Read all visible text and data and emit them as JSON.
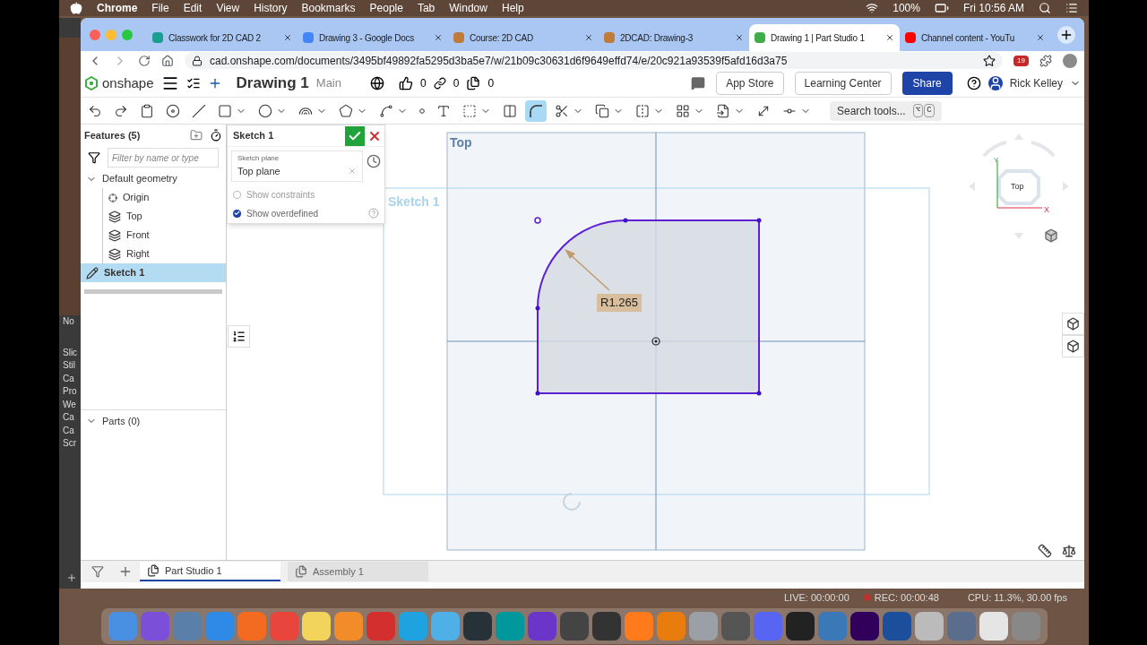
{
  "menu_bar": {
    "app": "Chrome",
    "menus": [
      "File",
      "Edit",
      "View",
      "History",
      "Bookmarks",
      "People",
      "Tab",
      "Window",
      "Help"
    ],
    "battery": "100%",
    "clock": "Fri 10:56 AM"
  },
  "background_window": {
    "lines": [
      "No",
      "Slic",
      "Stil",
      "Ca",
      "Pro",
      "We",
      "Ca",
      "Ca",
      "Scr"
    ]
  },
  "browser": {
    "tabs": [
      {
        "title": "Classwork for 2D CAD 2",
        "selected": false
      },
      {
        "title": "Drawing 3 - Google Docs",
        "selected": false
      },
      {
        "title": "Course: 2D CAD",
        "selected": false
      },
      {
        "title": "2DCAD: Drawing-3",
        "selected": false
      },
      {
        "title": "Drawing 1 | Part Studio 1",
        "selected": true
      },
      {
        "title": "Channel content - YouTu",
        "selected": false
      }
    ],
    "url": "cad.onshape.com/documents/3495bf49892fa5295d3ba5e7/w/21b09c30631d6f9649effd74/e/20c921a93539f5afd16d3a75",
    "extension_badge": "19"
  },
  "header": {
    "logo": "onshape",
    "document": "Drawing 1",
    "branch": "Main",
    "likes": "0",
    "links": "0",
    "copies": "0",
    "buttons": [
      "App Store",
      "Learning Center"
    ],
    "share": "Share",
    "user": "Rick Kelley"
  },
  "toolbar": {
    "tools": [
      {
        "selected": false
      },
      {
        "selected": false
      },
      {
        "selected": false
      },
      {
        "selected": false
      },
      {
        "selected": false
      },
      {
        "selected": false
      },
      {
        "selected": false
      },
      {
        "selected": false
      },
      {
        "selected": false
      },
      {
        "selected": false
      },
      {
        "selected": false
      },
      {
        "selected": false
      },
      {
        "selected": false
      },
      {
        "selected": false
      },
      {
        "selected": true
      },
      {
        "selected": false
      },
      {
        "selected": false
      },
      {
        "selected": false
      },
      {
        "selected": false
      },
      {
        "selected": false
      },
      {
        "selected": false
      },
      {
        "selected": false
      }
    ],
    "search": "Search tools...",
    "shortcut": [
      "⌥",
      "C"
    ]
  },
  "features": {
    "title": "Features (5)",
    "filter_placeholder": "Filter by name or type",
    "tree": [
      {
        "label": "Default geometry",
        "kind": "folder",
        "expanded": true,
        "selected": false,
        "children": [
          {
            "label": "Origin",
            "kind": "origin",
            "selected": false
          },
          {
            "label": "Top",
            "kind": "plane",
            "selected": false
          },
          {
            "label": "Front",
            "kind": "plane",
            "selected": false
          },
          {
            "label": "Right",
            "kind": "plane",
            "selected": false
          }
        ]
      },
      {
        "label": "Sketch 1",
        "kind": "sketch",
        "selected": true
      }
    ],
    "parts": {
      "label": "Parts (0)",
      "expanded": true
    }
  },
  "sketch_dialog": {
    "title": "Sketch 1",
    "plane_label": "Sketch plane",
    "plane_value": "Top plane",
    "options": [
      {
        "label": "Show constraints",
        "checked": false
      },
      {
        "label": "Show overdefined",
        "checked": true
      }
    ]
  },
  "viewport": {
    "plane_label": "Top",
    "sketch_label": "Sketch 1",
    "dimension": "R1.265",
    "view_cube": {
      "face": "Top",
      "y_axis": "Y",
      "x_axis": "X"
    }
  },
  "bottom_tabs": [
    {
      "label": "Part Studio 1",
      "selected": true
    },
    {
      "label": "Assembly 1",
      "selected": false
    }
  ],
  "recorder": {
    "live": "LIVE: 00:00:00",
    "rec": "REC: 00:00:48",
    "cpu": "CPU: 11.3%, 30.00 fps"
  }
}
